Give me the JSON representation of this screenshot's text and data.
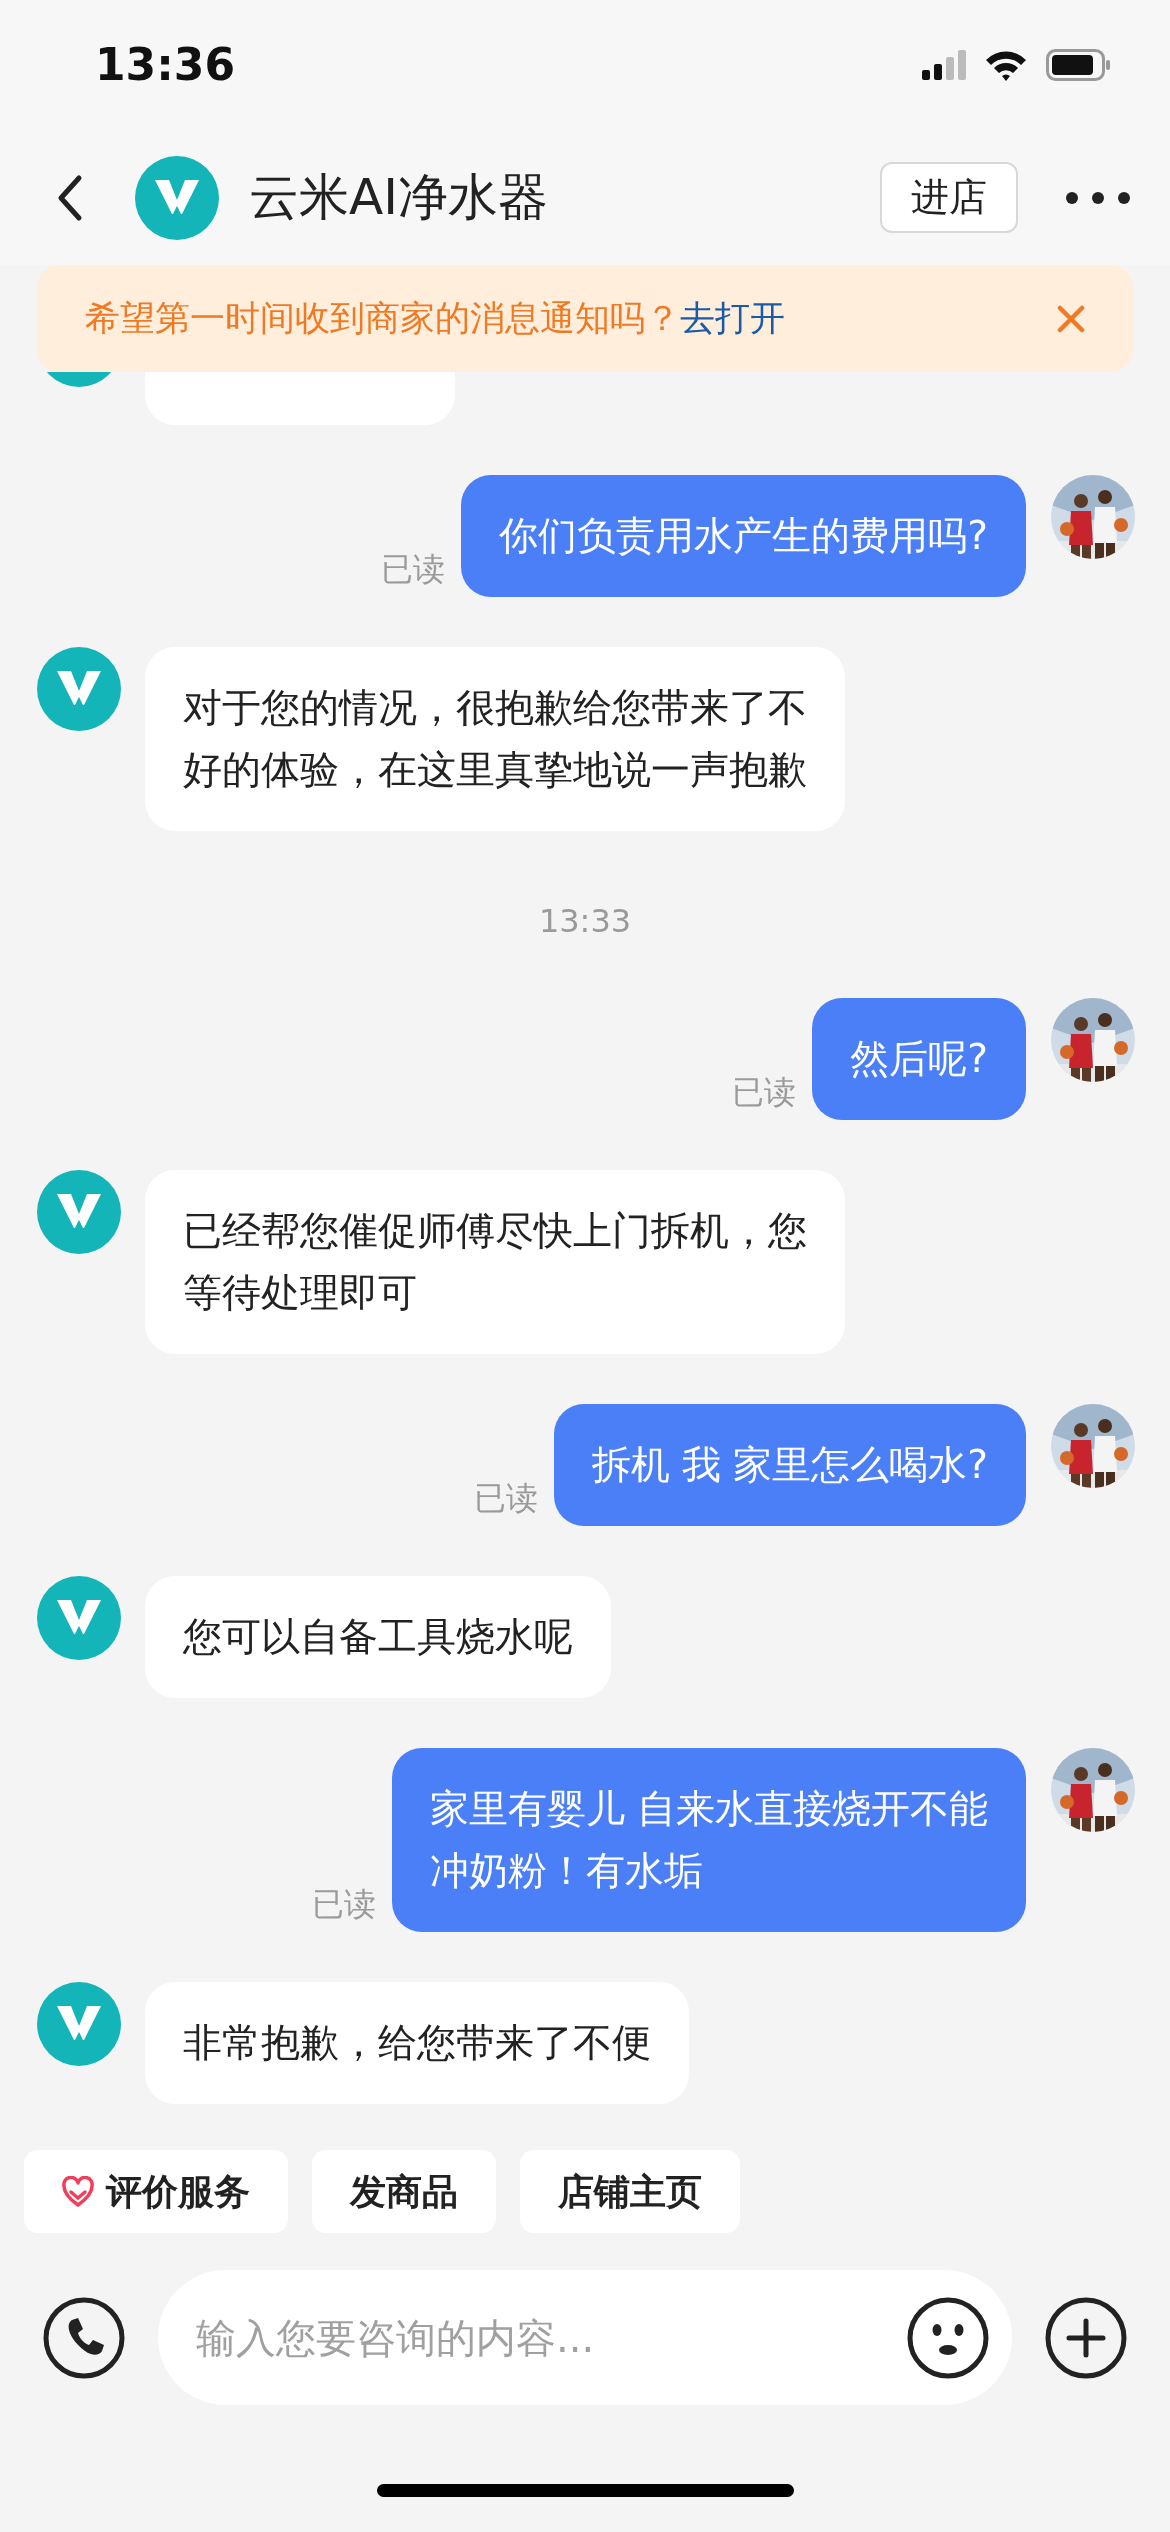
{
  "status_bar": {
    "time": "13:36"
  },
  "header": {
    "title": "云米AI净水器",
    "store_button": "进店"
  },
  "notice": {
    "text": "希望第一时间收到商家的消息通知吗？",
    "link": "去打开"
  },
  "messages": [
    {
      "kind": "partial",
      "from_user": false
    },
    {
      "kind": "message",
      "from_user": true,
      "lines": [
        "你们负责用水产生的费用吗?"
      ],
      "status": "已读"
    },
    {
      "kind": "message",
      "from_user": false,
      "lines": [
        "对于您的情况，很抱歉给您带来了不",
        "好的体验，在这里真挚地说一声抱歉"
      ]
    },
    {
      "kind": "time",
      "text": "13:33"
    },
    {
      "kind": "message",
      "from_user": true,
      "lines": [
        "然后呢?"
      ],
      "status": "已读"
    },
    {
      "kind": "message",
      "from_user": false,
      "lines": [
        "已经帮您催促师傅尽快上门拆机，您",
        "等待处理即可"
      ]
    },
    {
      "kind": "message",
      "from_user": true,
      "lines": [
        "拆机 我 家里怎么喝水?"
      ],
      "status": "已读"
    },
    {
      "kind": "message",
      "from_user": false,
      "lines": [
        "您可以自备工具烧水呢"
      ]
    },
    {
      "kind": "message",
      "from_user": true,
      "lines": [
        "家里有婴儿 自来水直接烧开不能",
        "冲奶粉！有水垢"
      ],
      "status": "已读"
    },
    {
      "kind": "message",
      "from_user": false,
      "lines": [
        "非常抱歉，给您带来了不便"
      ]
    }
  ],
  "quick_actions": [
    {
      "label": "评价服务",
      "has_icon": true
    },
    {
      "label": "发商品",
      "has_icon": false
    },
    {
      "label": "店铺主页",
      "has_icon": false
    }
  ],
  "input": {
    "placeholder": "输入您要咨询的内容..."
  }
}
